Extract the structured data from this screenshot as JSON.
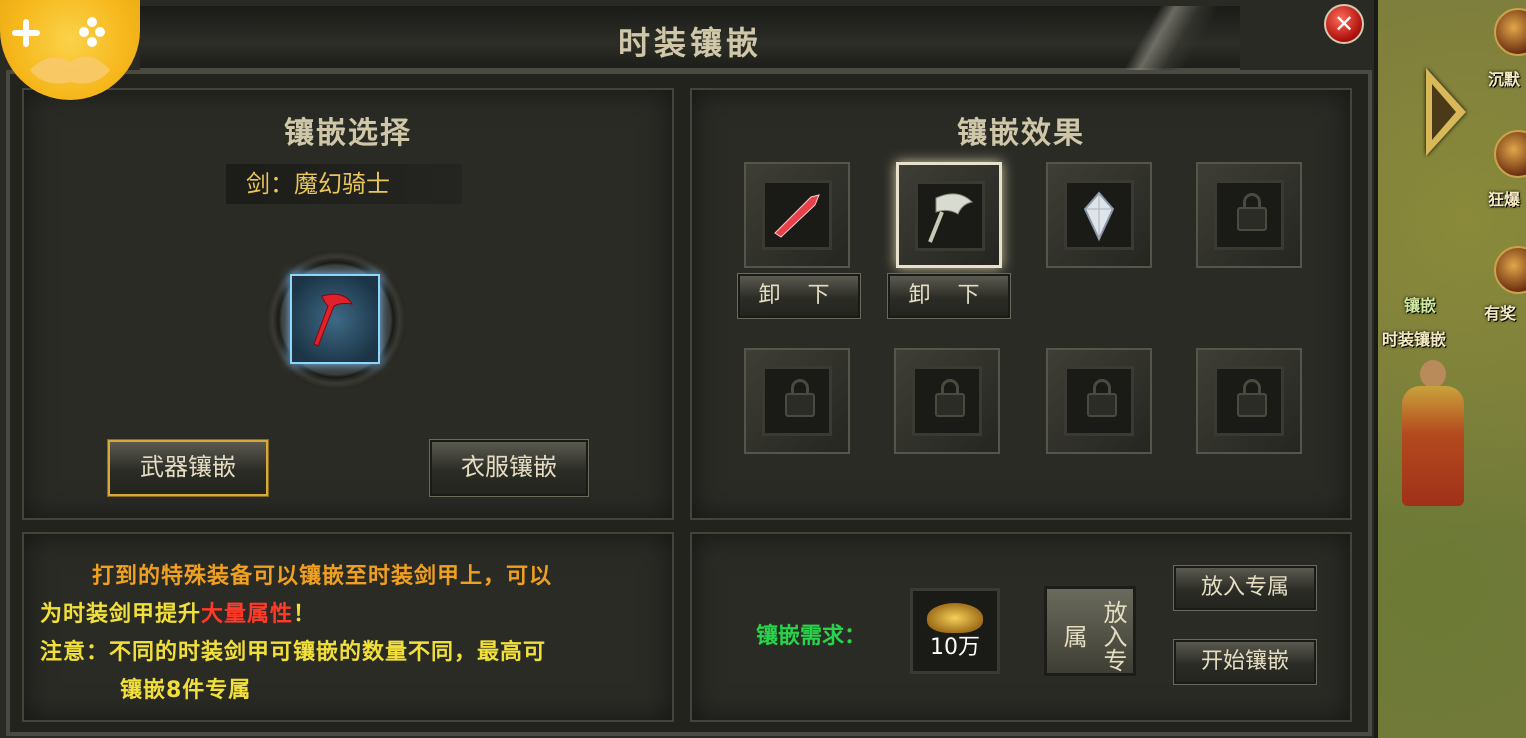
{
  "window": {
    "title": "时装镶嵌",
    "close_symbol": "✕"
  },
  "select_panel": {
    "title": "镶嵌选择",
    "weapon_name": "剑：魔幻骑士",
    "buttons": [
      {
        "label": "武器镶嵌",
        "selected": true
      },
      {
        "label": "衣服镶嵌",
        "selected": false
      }
    ]
  },
  "effect_panel": {
    "title": "镶嵌效果",
    "slots": [
      {
        "state": "filled",
        "item_icon": "red-blade-icon",
        "action": "卸 下"
      },
      {
        "state": "filled",
        "item_icon": "silver-axe-icon",
        "action": "卸 下",
        "highlight": true
      },
      {
        "state": "filled",
        "item_icon": "crystal-icon"
      },
      {
        "state": "locked"
      },
      {
        "state": "locked"
      },
      {
        "state": "locked"
      },
      {
        "state": "locked"
      },
      {
        "state": "locked"
      }
    ]
  },
  "info_panel": {
    "line1": "打到的特殊装备可以镶嵌至时装剑甲上，可以",
    "line2_part1": "为时装剑甲提升",
    "line2_part2": "大量属性",
    "line2_part3": "！",
    "line3": "注意：不同的时装剑甲可镶嵌的数量不同，最高可",
    "line4": "镶嵌8件专属"
  },
  "requirement_panel": {
    "label": "镶嵌需求：",
    "cost": "10万",
    "place_slot_label": "放入专属",
    "buttons": [
      "放入专属",
      "开始镶嵌"
    ]
  },
  "sidebar": {
    "items": [
      {
        "label": "沉默",
        "icon": "skull-icon"
      },
      {
        "label": "狂爆",
        "icon": "rage-icon"
      },
      {
        "label": "有奖",
        "icon": "reward-icon"
      }
    ],
    "npc_title_1": "镶嵌",
    "npc_title_2": "时装镶嵌"
  },
  "colors": {
    "text_gold": "#e8c65a",
    "text_orange": "#f0a020",
    "text_yellow": "#f2e03a",
    "text_red": "#ff3a2a",
    "text_green": "#27d44a",
    "slot_highlight": "#8fd6ff"
  }
}
